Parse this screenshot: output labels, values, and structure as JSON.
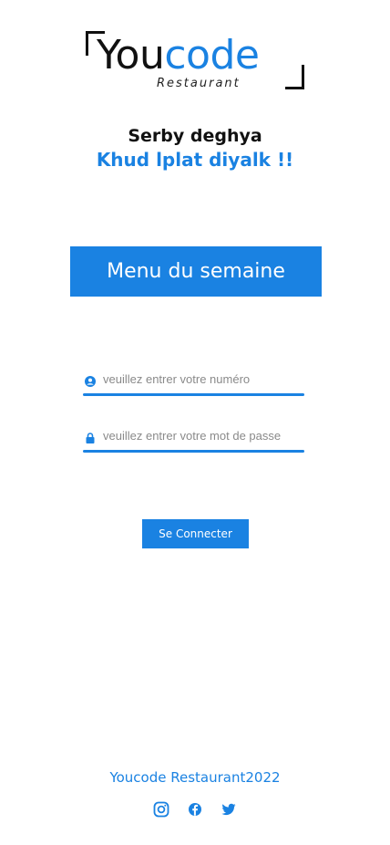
{
  "logo": {
    "word_black": "You",
    "word_blue": "code",
    "subtitle": "Restaurant"
  },
  "tagline": {
    "line1": "Serby deghya",
    "line2": "Khud lplat diyalk !!"
  },
  "menu_button": "Menu du semaine",
  "form": {
    "phone_placeholder": "veuillez entrer votre numéro",
    "password_placeholder": "veuillez entrer votre mot de passe",
    "submit_label": "Se Connecter"
  },
  "footer": {
    "text": "Youcode Restaurant2022"
  },
  "social": [
    "instagram-icon",
    "facebook-icon",
    "twitter-icon"
  ],
  "colors": {
    "accent": "#1a82e2",
    "text": "#111111"
  }
}
